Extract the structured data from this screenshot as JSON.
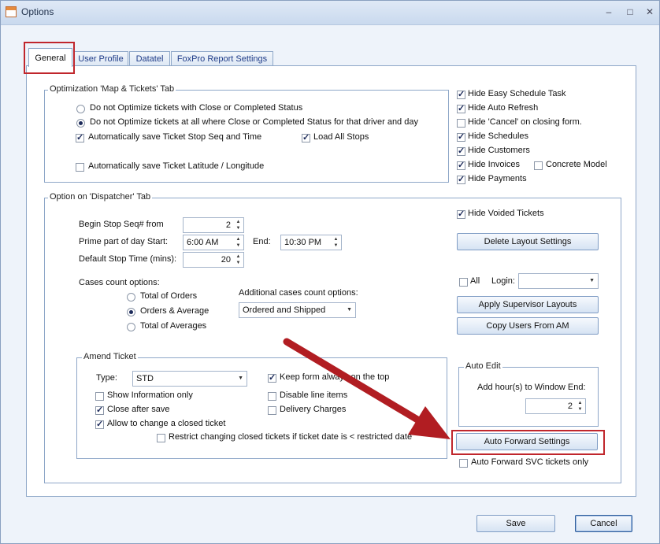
{
  "window": {
    "title": "Options",
    "minimize": "–",
    "maximize": "□",
    "close": "✕"
  },
  "tabs": [
    {
      "label": "General",
      "active": true
    },
    {
      "label": "User Profile"
    },
    {
      "label": "Datatel"
    },
    {
      "label": "FoxPro Report Settings"
    }
  ],
  "optimization": {
    "title": "Optimization 'Map & Tickets' Tab",
    "radio1": "Do not Optimize tickets with Close or Completed Status",
    "radio2": "Do not Optimize  tickets at all where Close or Completed Status for that driver and day",
    "auto_save_seq": "Automatically save Ticket Stop Seq and Time",
    "load_all_stops": "Load All Stops",
    "auto_save_latlong": "Automatically save Ticket Latitude / Longitude"
  },
  "right_checks": {
    "hide_easy_schedule": "Hide Easy Schedule Task",
    "hide_auto_refresh": "Hide Auto Refresh",
    "hide_cancel": "Hide 'Cancel' on closing form.",
    "hide_schedules": "Hide Schedules",
    "hide_customers": "Hide Customers",
    "hide_invoices": "Hide Invoices",
    "concrete_model": "Concrete Model",
    "hide_payments": "Hide Payments"
  },
  "dispatcher": {
    "title": "Option on 'Dispatcher' Tab",
    "begin_stop_label": "Begin Stop Seq# from",
    "begin_stop_value": "2",
    "prime_label": "Prime part of day Start:",
    "prime_start": "6:00 AM",
    "end_label": "End:",
    "prime_end": "10:30 PM",
    "default_stop_label": "Default Stop Time (mins):",
    "default_stop_value": "20",
    "cases_label": "Cases count options:",
    "case_opt1": "Total  of Orders",
    "case_opt2": "Orders & Average",
    "case_opt3": "Total of Averages",
    "additional_label": "Additional cases count options:",
    "additional_value": "Ordered and Shipped",
    "hide_voided": "Hide Voided Tickets",
    "delete_layout": "Delete Layout Settings",
    "all_label": "All",
    "login_label": "Login:",
    "login_value": "",
    "apply_supervisor": "Apply Supervisor Layouts",
    "copy_users": "Copy Users From AM"
  },
  "amend": {
    "title": "Amend Ticket",
    "type_label": "Type:",
    "type_value": "STD",
    "keep_on_top": "Keep form always on the top",
    "show_info_only": "Show Information only",
    "disable_line_items": "Disable line items",
    "close_after_save": "Close after save",
    "delivery_charges": "Delivery Charges",
    "allow_change_closed": "Allow to change a closed ticket",
    "restrict_changing": "Restrict changing closed tickets if ticket date is < restricted date"
  },
  "auto_edit": {
    "title": "Auto Edit",
    "add_hours_label": "Add hour(s) to Window End:",
    "add_hours_value": "2"
  },
  "auto_forward": {
    "button": "Auto Forward Settings",
    "svc_only": "Auto Forward SVC tickets only"
  },
  "footer": {
    "save": "Save",
    "cancel": "Cancel"
  },
  "colors": {
    "highlight_red": "#c0262c",
    "arrow_red": "#b11d22"
  },
  "icons": {
    "spin": "up-down-arrows",
    "dropdown": "chevron-down-icon"
  }
}
